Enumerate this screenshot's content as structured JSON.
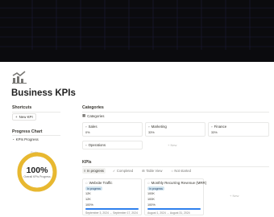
{
  "page": {
    "title": "Business KPIs"
  },
  "shortcuts": {
    "label": "Shortcuts",
    "new_kpi": "New KPI"
  },
  "progress_chart": {
    "label": "Progress Chart",
    "link": "KPIs Progress",
    "top_label": "Goals",
    "percent": 100,
    "percent_text": "100%",
    "sub_label": "Overall KPIs Progress"
  },
  "categories": {
    "label": "Categories",
    "view_label": "Categories",
    "items": [
      {
        "name": "Sales",
        "percent_text": "0%"
      },
      {
        "name": "Marketing",
        "percent_text": "33%"
      },
      {
        "name": "Finance",
        "percent_text": "33%"
      },
      {
        "name": "Operations",
        "percent_text": ""
      }
    ],
    "new_label": "+ New"
  },
  "kpis": {
    "label": "KPIs",
    "tabs": [
      "In progress",
      "Completed",
      "Table View",
      "Not started"
    ],
    "cards": [
      {
        "title": "Website Traffic",
        "status": "In progress",
        "line1": "12K",
        "line2": "12K",
        "percent_text": "100%",
        "percent": 100,
        "dates": "September 3, 2024 → September 17, 2024"
      },
      {
        "title": "Monthly Recurring Revenue (MRR)",
        "status": "In progress",
        "line1": "100K",
        "line2": "100K",
        "percent_text": "100%",
        "percent": 100,
        "dates": "August 1, 2024 → August 31, 2024"
      }
    ],
    "new_label": "+ New"
  },
  "colors": {
    "ring": "#e8b830",
    "ring_track": "#eeeeee",
    "bar": "#2f80ed",
    "cover": "#0b0b0e"
  }
}
